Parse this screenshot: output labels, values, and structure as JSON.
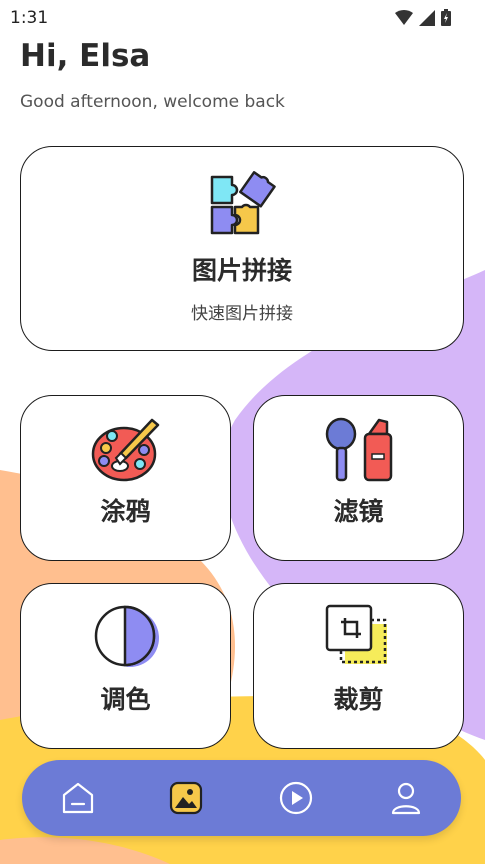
{
  "status": {
    "time": "1:31"
  },
  "header": {
    "greeting": "Hi, Elsa",
    "subtitle": "Good afternoon, welcome back"
  },
  "features": {
    "collage": {
      "title": "图片拼接",
      "subtitle": "快速图片拼接",
      "icon": "puzzle-icon"
    },
    "doodle": {
      "title": "涂鸦",
      "icon": "palette-icon"
    },
    "filter": {
      "title": "滤镜",
      "icon": "filter-tools-icon"
    },
    "color": {
      "title": "调色",
      "icon": "half-circle-icon"
    },
    "crop": {
      "title": "裁剪",
      "icon": "crop-icon"
    }
  },
  "bottom_nav": {
    "items": [
      {
        "icon": "home-icon",
        "active": false
      },
      {
        "icon": "gallery-icon",
        "active": true
      },
      {
        "icon": "play-icon",
        "active": false
      },
      {
        "icon": "profile-icon",
        "active": false
      }
    ]
  },
  "colors": {
    "nav_bg": "#6c7bd6",
    "bg_purple": "#d5b6f8",
    "bg_orange": "#ffbf8f",
    "bg_yellow": "#ffd24a",
    "accent_yellow": "#f6c84a"
  }
}
